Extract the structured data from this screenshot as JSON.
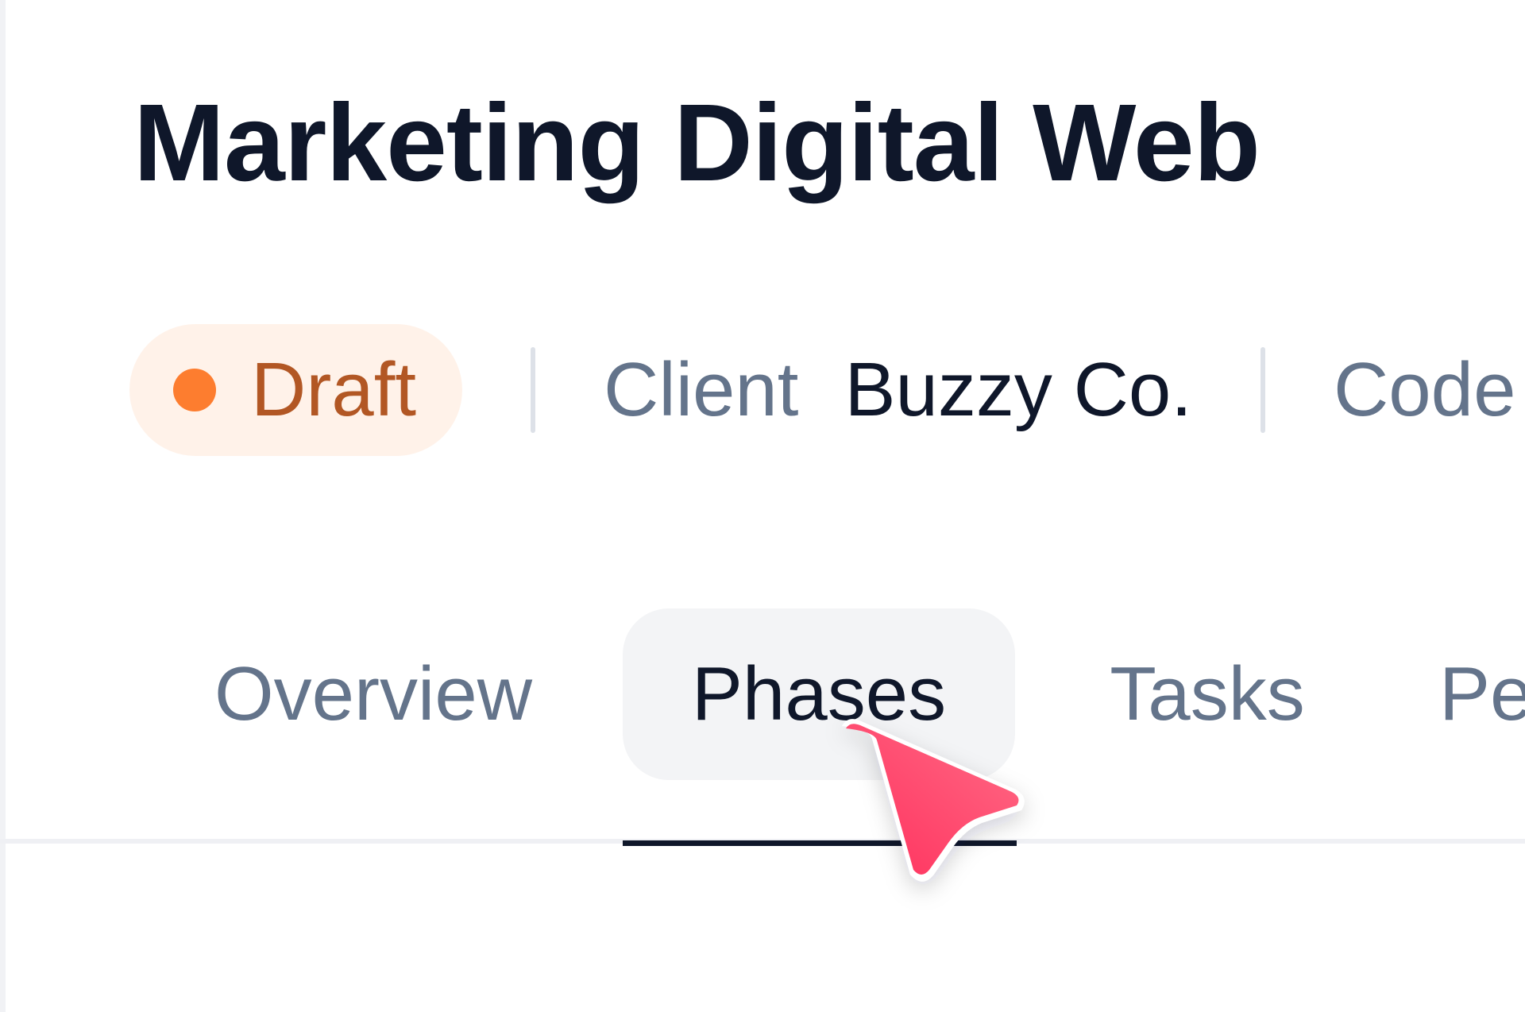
{
  "project": {
    "title": "Marketing Digital Web"
  },
  "meta": {
    "status": {
      "label": "Draft",
      "color": "#fd7d2f"
    },
    "client": {
      "key": "Client",
      "value": "Buzzy Co."
    },
    "code": {
      "key": "Code"
    }
  },
  "tabs": [
    {
      "label": "Overview",
      "active": false
    },
    {
      "label": "Phases",
      "active": true
    },
    {
      "label": "Tasks",
      "active": false
    },
    {
      "label": "Pe",
      "active": false
    }
  ],
  "cursor": {
    "icon": "pointer-cursor-icon",
    "color": "#ff3d6b"
  }
}
